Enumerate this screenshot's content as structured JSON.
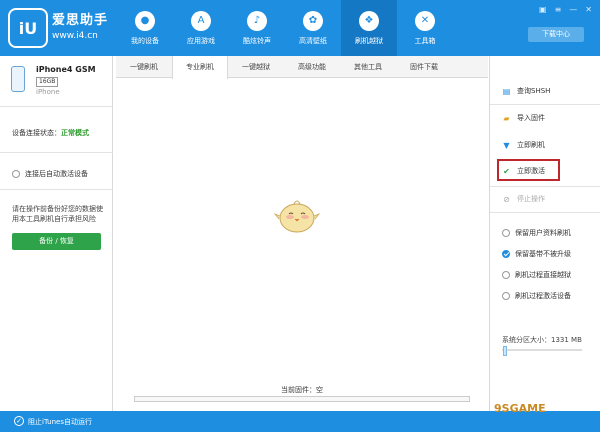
{
  "header": {
    "logo_text": "iU",
    "brand_name": "爱思助手",
    "brand_url": "www.i4.cn",
    "nav": [
      {
        "label": "我的设备",
        "icon": "apple-icon"
      },
      {
        "label": "应用游戏",
        "icon": "app-store-icon"
      },
      {
        "label": "酷炫铃声",
        "icon": "bell-icon"
      },
      {
        "label": "高清壁纸",
        "icon": "flower-icon"
      },
      {
        "label": "刷机越狱",
        "icon": "box-icon"
      },
      {
        "label": "工具箱",
        "icon": "tools-icon"
      }
    ],
    "active_nav": 4,
    "download_label": "下载中心"
  },
  "device": {
    "name": "iPhone4 GSM",
    "capacity": "16GB",
    "model": "iPhone",
    "connection_label": "设备连接状态：",
    "connection_status": "正常模式",
    "auto_activate": "连接后自动激活设备",
    "tip": "请在操作前备份好您的数据使用本工具刷机自行承担风险",
    "backup_button": "备份 / 恢复"
  },
  "tabs": [
    "一键刷机",
    "专业刷机",
    "一键越狱",
    "高级功能",
    "其他工具",
    "固件下载"
  ],
  "active_tab": 1,
  "center": {
    "firmware_label": "当前固件：空"
  },
  "actions": {
    "query_shsh": "查询SHSH",
    "import_firmware": "导入固件",
    "flash_now": "立即刷机",
    "activate_now": "立即激活",
    "stop": "停止操作"
  },
  "options": [
    {
      "label": "保留用户资料刷机",
      "checked": false
    },
    {
      "label": "保留基带不被升级",
      "checked": true
    },
    {
      "label": "刷机过程直接越狱",
      "checked": false
    },
    {
      "label": "刷机过程激活设备",
      "checked": false
    }
  ],
  "partition": {
    "label": "系统分区大小：",
    "value": "1331 MB"
  },
  "statusbar": {
    "itunes": "阻止iTunes自动运行"
  },
  "watermark": "9SGAME",
  "colors": {
    "primary": "#1e8ee0",
    "success": "#2fa34a",
    "highlight": "#c0272d"
  }
}
